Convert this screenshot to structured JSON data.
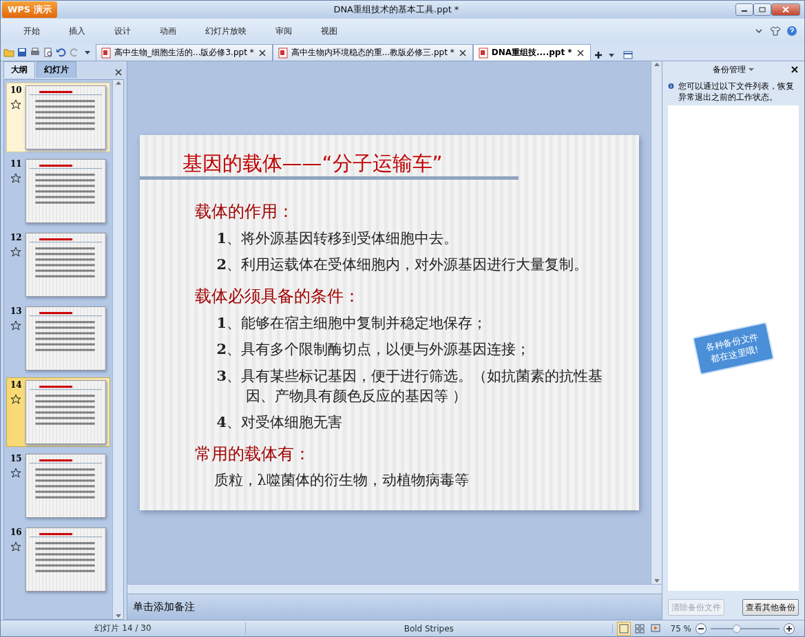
{
  "app": {
    "logo": "WPS 演示"
  },
  "window": {
    "title": "DNA重组技术的基本工具.ppt *"
  },
  "menu": [
    {
      "label": "开始"
    },
    {
      "label": "插入"
    },
    {
      "label": "设计"
    },
    {
      "label": "动画"
    },
    {
      "label": "幻灯片放映"
    },
    {
      "label": "审阅"
    },
    {
      "label": "视图"
    }
  ],
  "doc_tabs": [
    {
      "label": "高中生物_细胞生活的...版必修3.ppt *",
      "selected": false
    },
    {
      "label": "高中生物内环境稳态的重...教版必修三.ppt *",
      "selected": false
    },
    {
      "label": "DNA重组技....ppt *",
      "selected": true
    }
  ],
  "panel_tabs": [
    {
      "label": "大纲",
      "selected": false
    },
    {
      "label": "幻灯片",
      "selected": true
    }
  ],
  "slides": [
    {
      "number": "10",
      "selected": false,
      "hovered": true
    },
    {
      "number": "11",
      "selected": false,
      "hovered": false
    },
    {
      "number": "12",
      "selected": false,
      "hovered": false
    },
    {
      "number": "13",
      "selected": false,
      "hovered": false
    },
    {
      "number": "14",
      "selected": true,
      "hovered": false
    },
    {
      "number": "15",
      "selected": false,
      "hovered": false
    },
    {
      "number": "16",
      "selected": false,
      "hovered": false
    }
  ],
  "slide": {
    "title": "基因的载体——“分子运输车”",
    "sections": [
      {
        "heading": "载体的作用：",
        "items": [
          "**1**、将外源基因转移到受体细胞中去。",
          "**2**、利用运载体在受体细胞内，对外源基因进行大量复制。"
        ]
      },
      {
        "heading": "载体必须具备的条件：",
        "items": [
          "**1**、能够在宿主细胞中复制并稳定地保存；",
          "**2**、具有多个限制酶切点，以便与外源基因连接；",
          "**3**、具有某些标记基因，便于进行筛选。（如抗菌素的抗性基因、产物具有颜色反应的基因等 ）",
          "**4**、对受体细胞无害"
        ]
      },
      {
        "heading": "常用的载体有：",
        "text": "质粒，λ噬菌体的衍生物，动植物病毒等"
      }
    ]
  },
  "notes": {
    "placeholder": "单击添加备注"
  },
  "backup_pane": {
    "title": "备份管理",
    "info": "您可以通过以下文件列表，恢复异常退出之前的工作状态。",
    "sign": "各种备份文件都在这里哦!",
    "buttons": [
      {
        "label": "清除备份文件",
        "disabled": true
      },
      {
        "label": "查看其他备份",
        "disabled": false
      }
    ]
  },
  "status_bar": {
    "slide_count": "幻灯片 14 / 30",
    "theme": "Bold Stripes",
    "views": [
      {
        "selected": true
      },
      {
        "selected": false
      },
      {
        "selected": false
      }
    ],
    "zoom": "75 %",
    "zoom_level": {
      "level": 0.38
    }
  }
}
